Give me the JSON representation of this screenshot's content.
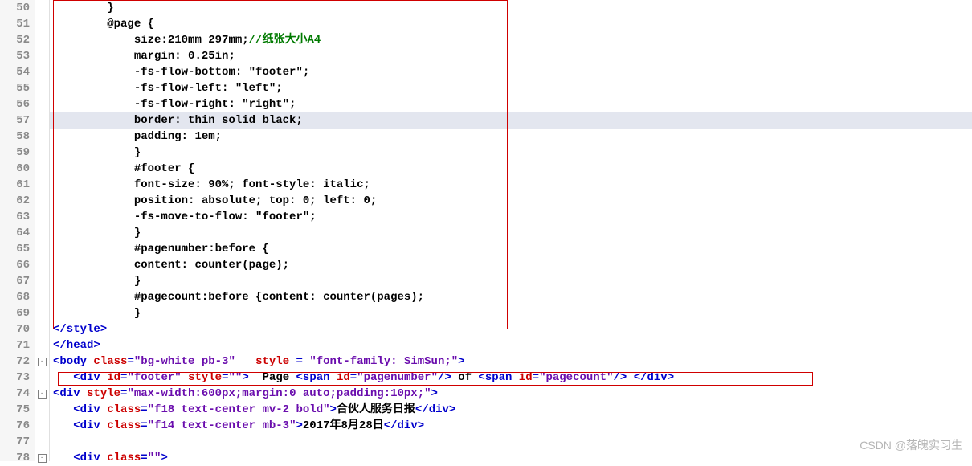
{
  "watermark": "CSDN @落魄实习生",
  "line_numbers": [
    "50",
    "51",
    "52",
    "53",
    "54",
    "55",
    "56",
    "57",
    "58",
    "59",
    "60",
    "61",
    "62",
    "63",
    "64",
    "65",
    "66",
    "67",
    "68",
    "69",
    "70",
    "71",
    "72",
    "73",
    "74",
    "75",
    "76",
    "77",
    "78"
  ],
  "fold_marks": [
    {
      "line": 72,
      "symbol": "-"
    },
    {
      "line": 74,
      "symbol": "-"
    },
    {
      "line": 78,
      "symbol": "-"
    }
  ],
  "highlight_line": 57,
  "code": {
    "l50": {
      "indent": "        ",
      "a": "}"
    },
    "l51": {
      "indent": "        ",
      "a": "@page {"
    },
    "l52": {
      "indent": "            ",
      "a": "size:210mm 297mm;",
      "b": "//纸张大小A4"
    },
    "l53": {
      "indent": "            ",
      "a": "margin: 0.25in;"
    },
    "l54": {
      "indent": "            ",
      "a": "-fs-flow-bottom: \"footer\";"
    },
    "l55": {
      "indent": "            ",
      "a": "-fs-flow-left: \"left\";"
    },
    "l56": {
      "indent": "            ",
      "a": "-fs-flow-right: \"right\";"
    },
    "l57": {
      "indent": "            ",
      "a": "border: thin solid black;"
    },
    "l58": {
      "indent": "            ",
      "a": "padding: 1em;"
    },
    "l59": {
      "indent": "            ",
      "a": "}"
    },
    "l60": {
      "indent": "            ",
      "a": "#footer {"
    },
    "l61": {
      "indent": "            ",
      "a": "font-size: 90%; font-style: italic;"
    },
    "l62": {
      "indent": "            ",
      "a": "position: absolute; top: 0; left: 0;"
    },
    "l63": {
      "indent": "            ",
      "a": "-fs-move-to-flow: \"footer\";"
    },
    "l64": {
      "indent": "            ",
      "a": "}"
    },
    "l65": {
      "indent": "            ",
      "a": "#pagenumber:before {"
    },
    "l66": {
      "indent": "            ",
      "a": "content: counter(page);"
    },
    "l67": {
      "indent": "            ",
      "a": "}"
    },
    "l68": {
      "indent": "            ",
      "a": "#pagecount:before {content: counter(pages);"
    },
    "l69": {
      "indent": "            ",
      "a": "}"
    },
    "l70": {
      "a": "</style>"
    },
    "l71": {
      "a": "</head>"
    },
    "l72": {
      "open": "<body ",
      "attr1": "class",
      "eq1": "=",
      "v1": "\"bg-white pb-3\"",
      "sp": "   ",
      "attr2": "style",
      "eq2": " = ",
      "v2": "\"font-family: SimSun;\"",
      "close": ">"
    },
    "l73": {
      "indent": "   ",
      "open": "<div ",
      "attr1": "id",
      "eq1": "=",
      "v1": "\"footer\"",
      "sp": " ",
      "attr2": "style",
      "eq2": "=",
      "v2": "\"\"",
      "close": ">",
      "txt": "  Page ",
      "open2": "<span ",
      "attr3": "id",
      "eq3": "=",
      "v3": "\"pagenumber\"",
      "close2": "/>",
      "txt2": " of ",
      "open3": "<span ",
      "attr4": "id",
      "eq4": "=",
      "v4": "\"pagecount\"",
      "close3": "/>",
      "txt3": " ",
      "close4": "</div>"
    },
    "l74": {
      "open": "<div ",
      "attr1": "style",
      "eq1": "=",
      "v1": "\"max-width:600px;margin:0 auto;padding:10px;\"",
      "close": ">"
    },
    "l75": {
      "indent": "   ",
      "open": "<div ",
      "attr1": "class",
      "eq1": "=",
      "v1": "\"f18 text-center mv-2 bold\"",
      "close": ">",
      "txt": "合伙人服务日报",
      "close2": "</div>"
    },
    "l76": {
      "indent": "   ",
      "open": "<div ",
      "attr1": "class",
      "eq1": "=",
      "v1": "\"f14 text-center mb-3\"",
      "close": ">",
      "txt": "2017年8月28日",
      "close2": "</div>"
    },
    "l77": {
      "a": " "
    },
    "l78": {
      "indent": "   ",
      "open": "<div ",
      "attr1": "class",
      "eq1": "=",
      "v1": "\"\"",
      "close": ">"
    }
  }
}
